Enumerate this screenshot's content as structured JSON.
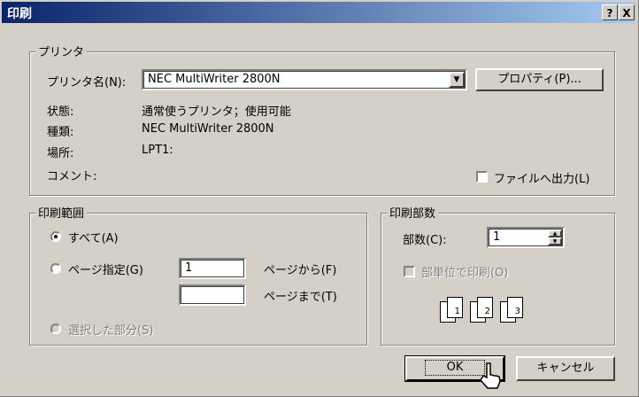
{
  "window": {
    "title": "印刷",
    "help_btn": "?",
    "close_btn": "X"
  },
  "printer": {
    "group_label": "プリンタ",
    "name_label": "プリンタ名(N):",
    "name_value": "NEC MultiWriter 2800N",
    "properties_button": "プロパティ(P)...",
    "status_label": "状態:",
    "status_value": "通常使うプリンタ；使用可能",
    "type_label": "種類:",
    "type_value": "NEC MultiWriter 2800N",
    "location_label": "場所:",
    "location_value": "LPT1:",
    "comment_label": "コメント:",
    "print_to_file": "ファイルへ出力(L)"
  },
  "range": {
    "group_label": "印刷範囲",
    "all_label": "すべて(A)",
    "pages_label": "ページ指定(G)",
    "from_value": "1",
    "to_value": "",
    "from_suffix": "ページから(F)",
    "to_suffix": "ページまで(T)",
    "selection_label": "選択した部分(S)"
  },
  "copies": {
    "group_label": "印刷部数",
    "count_label": "部数(C):",
    "count_value": "1",
    "collate_label": "部単位で印刷(O)",
    "page_icons": [
      "1",
      "1",
      "2",
      "2",
      "3",
      "3"
    ]
  },
  "buttons": {
    "ok": "OK",
    "cancel": "キャンセル"
  }
}
